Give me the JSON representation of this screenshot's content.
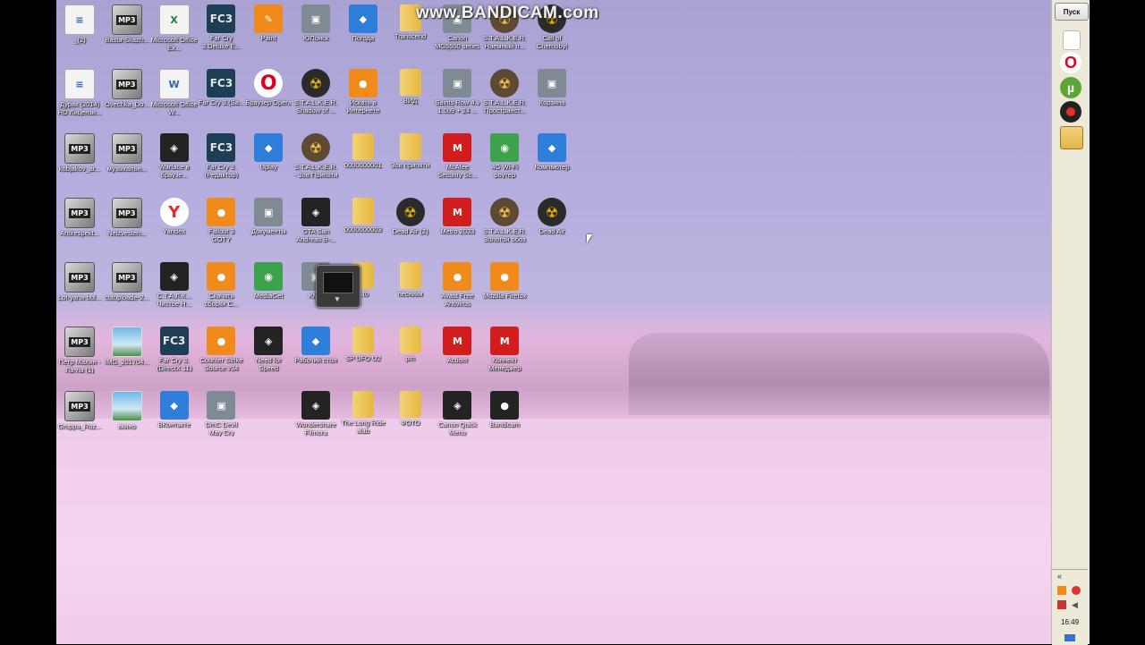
{
  "watermark": "www.BANDICAM.com",
  "start_label": "Пуск",
  "clock": "16:49",
  "tray_chevron": "«",
  "icons": [
    {
      "label": "_(2)",
      "kind": "doc",
      "col": 0,
      "row": 0
    },
    {
      "label": "Basta-Skazh...",
      "kind": "mp3",
      "col": 1,
      "row": 0
    },
    {
      "label": "Microsoft Office Ex...",
      "kind": "xls",
      "col": 2,
      "row": 0
    },
    {
      "label": "Far Cry 3.Deluxe E...",
      "kind": "fc3",
      "col": 3,
      "row": 0
    },
    {
      "label": "Paint",
      "kind": "paint",
      "col": 4,
      "row": 0
    },
    {
      "label": "ЮПоиск",
      "kind": "gray",
      "col": 5,
      "row": 0
    },
    {
      "label": "Погода",
      "kind": "blue",
      "col": 6,
      "row": 0
    },
    {
      "label": "Transcend",
      "kind": "folder",
      "col": 7,
      "row": 0
    },
    {
      "label": "Canon MG5500 series Элек...",
      "kind": "gray",
      "col": 8,
      "row": 0
    },
    {
      "label": "S.T.A.L.K.E.R. Наемный п...",
      "kind": "stalker",
      "col": 9,
      "row": 0
    },
    {
      "label": "Call of Chernobyl",
      "kind": "rad",
      "col": 10,
      "row": 0
    },
    {
      "label": "Дурак (2014) HD Лицензи...",
      "kind": "doc",
      "col": 0,
      "row": 1
    },
    {
      "label": "Ovechka_Do...",
      "kind": "mp3",
      "col": 1,
      "row": 1
    },
    {
      "label": "Microsoft Office W...",
      "kind": "docw",
      "col": 2,
      "row": 1
    },
    {
      "label": "Far Cry 3.(Sa...",
      "kind": "fc3",
      "col": 3,
      "row": 1
    },
    {
      "label": "Браузер Opera",
      "kind": "opera",
      "col": 4,
      "row": 1
    },
    {
      "label": "S.T.A.L.K.E.R. Shadow of ...",
      "kind": "rad",
      "col": 5,
      "row": 1
    },
    {
      "label": "Искать в Интернете",
      "kind": "orange",
      "col": 6,
      "row": 1
    },
    {
      "label": "ВИД",
      "kind": "folder",
      "col": 7,
      "row": 1
    },
    {
      "label": "Saints Row 4.v 1.0u9 + 24 ...",
      "kind": "gray",
      "col": 8,
      "row": 1
    },
    {
      "label": "S.T.A.L.K.E.R. Пространст...",
      "kind": "stalker",
      "col": 9,
      "row": 1
    },
    {
      "label": "Корзина",
      "kind": "gray",
      "col": 10,
      "row": 1
    },
    {
      "label": "kobjakov_ar...",
      "kind": "mp3",
      "col": 0,
      "row": 2
    },
    {
      "label": "музыкальн...",
      "kind": "mp3",
      "col": 1,
      "row": 2
    },
    {
      "label": "Warface в браузе...",
      "kind": "dark",
      "col": 2,
      "row": 2
    },
    {
      "label": "Far Cry 3.(Редактор)",
      "kind": "fc3",
      "col": 3,
      "row": 2
    },
    {
      "label": "Uplay",
      "kind": "blue",
      "col": 4,
      "row": 2
    },
    {
      "label": "S.T.A.L.K.E.R. - Зов Припяти",
      "kind": "stalker",
      "col": 5,
      "row": 2
    },
    {
      "label": "0000000001",
      "kind": "folder",
      "col": 6,
      "row": 2
    },
    {
      "label": "Зов припяти",
      "kind": "folder",
      "col": 7,
      "row": 2
    },
    {
      "label": "McAfee Security Sc...",
      "kind": "red",
      "col": 8,
      "row": 2
    },
    {
      "label": "4G Wi-Fi роутер",
      "kind": "green",
      "col": 9,
      "row": 2
    },
    {
      "label": "Компьютер",
      "kind": "blue",
      "col": 10,
      "row": 2
    },
    {
      "label": "Antirespekt...",
      "kind": "mp3",
      "col": 0,
      "row": 3
    },
    {
      "label": "Neizvesten...",
      "kind": "mp3",
      "col": 1,
      "row": 3
    },
    {
      "label": "Yandex",
      "kind": "ya",
      "col": 2,
      "row": 3
    },
    {
      "label": "Fallout 3 GOTY",
      "kind": "orange",
      "col": 3,
      "row": 3
    },
    {
      "label": "Документы",
      "kind": "gray",
      "col": 4,
      "row": 3
    },
    {
      "label": "GTA San Andreas В-...",
      "kind": "dark",
      "col": 5,
      "row": 3
    },
    {
      "label": "0000000003",
      "kind": "folder",
      "col": 6,
      "row": 3
    },
    {
      "label": "Dead Air (2)",
      "kind": "rad",
      "col": 7,
      "row": 3
    },
    {
      "label": "Metro 2033",
      "kind": "red",
      "col": 8,
      "row": 3
    },
    {
      "label": "S.T.A.L.K.E.R. Золотой обоз",
      "kind": "stalker",
      "col": 9,
      "row": 3
    },
    {
      "label": "Dead Air",
      "kind": "rad",
      "col": 10,
      "row": 3
    },
    {
      "label": "Lot-yana-bul...",
      "kind": "mp3",
      "col": 0,
      "row": 4
    },
    {
      "label": "cutuploade-2...",
      "kind": "mp3",
      "col": 1,
      "row": 4
    },
    {
      "label": "С.Т.А.Л.К... Чистое Н...",
      "kind": "dark",
      "col": 2,
      "row": 4
    },
    {
      "label": "Скачать сборки С...",
      "kind": "orange",
      "col": 3,
      "row": 4
    },
    {
      "label": "MediaGet",
      "kind": "green",
      "col": 4,
      "row": 4
    },
    {
      "label": "KMP",
      "kind": "gray",
      "col": 5,
      "row": 4
    },
    {
      "label": "...to",
      "kind": "folder",
      "col": 6,
      "row": 4
    },
    {
      "label": "песники",
      "kind": "folder",
      "col": 7,
      "row": 4
    },
    {
      "label": "Avast Free Antivirus",
      "kind": "orange",
      "col": 8,
      "row": 4
    },
    {
      "label": "Mozilla Firefox",
      "kind": "orange",
      "col": 9,
      "row": 4
    },
    {
      "label": "Петр Малин - Ла-ла (1)",
      "kind": "mp3",
      "col": 0,
      "row": 5
    },
    {
      "label": "IMG_201704...",
      "kind": "img",
      "col": 1,
      "row": 5
    },
    {
      "label": "Far Cry 3.(DirectX 11)",
      "kind": "fc3",
      "col": 2,
      "row": 5
    },
    {
      "label": "Counter Strike Source v34",
      "kind": "orange",
      "col": 3,
      "row": 5
    },
    {
      "label": "Need for Speed",
      "kind": "dark",
      "col": 4,
      "row": 5
    },
    {
      "label": "Рабочий стол",
      "kind": "blue",
      "col": 5,
      "row": 5
    },
    {
      "label": "SP UFO U2",
      "kind": "folder",
      "col": 6,
      "row": 5
    },
    {
      "label": "pm",
      "kind": "folder",
      "col": 7,
      "row": 5
    },
    {
      "label": "Action!",
      "kind": "red",
      "col": 8,
      "row": 5
    },
    {
      "label": "Коннект Менеджер",
      "kind": "red",
      "col": 9,
      "row": 5
    },
    {
      "label": "Gruppa_Roz...",
      "kind": "mp3",
      "col": 0,
      "row": 6
    },
    {
      "label": "вкино",
      "kind": "img",
      "col": 1,
      "row": 6
    },
    {
      "label": "ВКонтакте",
      "kind": "blue",
      "col": 2,
      "row": 6
    },
    {
      "label": "DmC Devil May Cry",
      "kind": "gray",
      "col": 3,
      "row": 6
    },
    {
      "label": "Wondershare Filmora",
      "kind": "dark",
      "col": 5,
      "row": 6
    },
    {
      "label": "The Long Ride alab",
      "kind": "folder",
      "col": 6,
      "row": 6
    },
    {
      "label": "ФОТО",
      "kind": "folder",
      "col": 7,
      "row": 6
    },
    {
      "label": "Canon Quick Menu",
      "kind": "dark",
      "col": 8,
      "row": 6
    },
    {
      "label": "Bandicam",
      "kind": "rec",
      "col": 9,
      "row": 6
    }
  ],
  "quick_launch": [
    {
      "name": "document",
      "kind": "doc"
    },
    {
      "name": "opera",
      "kind": "opera"
    },
    {
      "name": "utorrent",
      "kind": "ut"
    },
    {
      "name": "bandicam",
      "kind": "rec"
    },
    {
      "name": "show-desktop",
      "kind": "win"
    }
  ]
}
